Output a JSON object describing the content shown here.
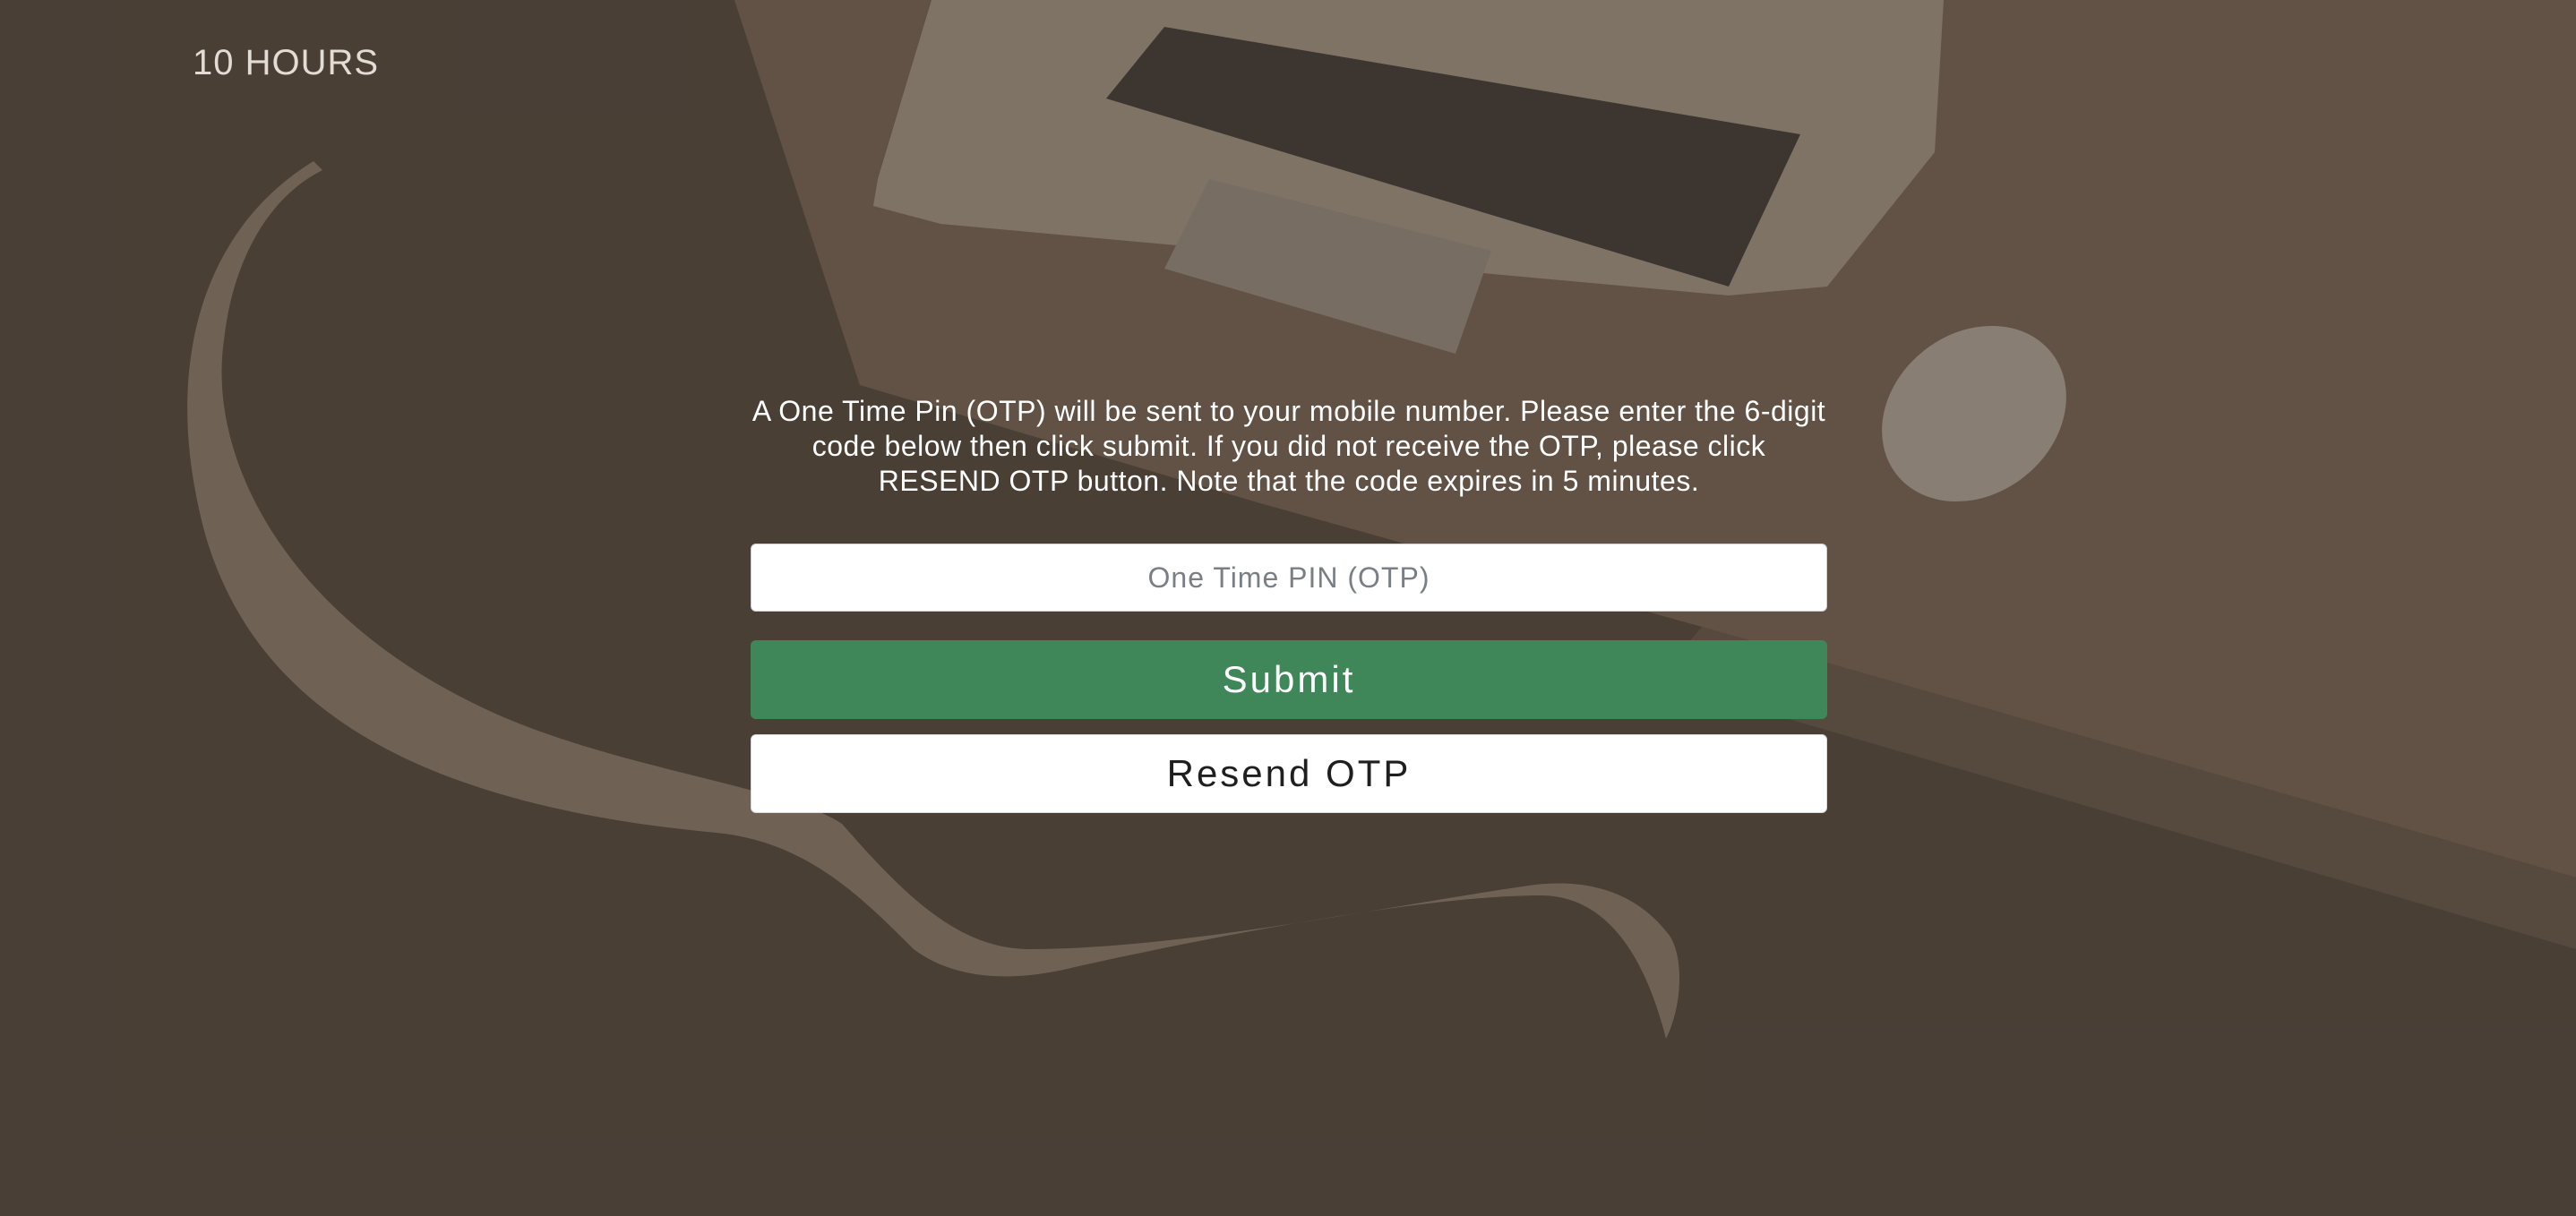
{
  "brand": {
    "name": "10 HOURS"
  },
  "otp": {
    "instructions": "A One Time Pin (OTP) will be sent to your mobile number. Please enter the 6-digit code below then click submit. If you did not receive the OTP, please click RESEND OTP button. Note that the code expires in 5 minutes.",
    "input_placeholder": "One Time PIN (OTP)",
    "input_value": "",
    "submit_label": "Submit",
    "resend_label": "Resend OTP"
  },
  "colors": {
    "submit_bg": "#3f8758",
    "background": "#4d4239",
    "text": "#ffffff"
  }
}
